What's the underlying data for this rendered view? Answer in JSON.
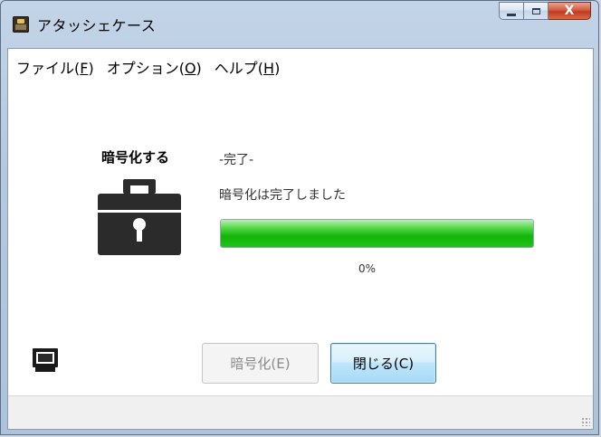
{
  "window": {
    "title": "アタッシェケース",
    "close_glyph": "X"
  },
  "menu": {
    "file": {
      "label": "ファイル(",
      "mnemonic": "F",
      "suffix": ")"
    },
    "options": {
      "label": "オプション(",
      "mnemonic": "O",
      "suffix": ")"
    },
    "help": {
      "label": "ヘルプ(",
      "mnemonic": "H",
      "suffix": ")"
    }
  },
  "operation": {
    "heading": "暗号化する",
    "status": "-完了-",
    "message": "暗号化は完了しました",
    "progress_fraction": 1.0,
    "percent_text": "0%"
  },
  "buttons": {
    "encrypt_label": "暗号化(E)",
    "close_label": "閉じる(C)"
  },
  "icons": {
    "app": "briefcase-app-icon",
    "case": "briefcase-lock-icon",
    "monitor": "monitor-icon"
  },
  "colors": {
    "progress_green": "#11b509",
    "close_button_border": "#3c7fb1",
    "titlebar_close": "#c13b1d"
  }
}
